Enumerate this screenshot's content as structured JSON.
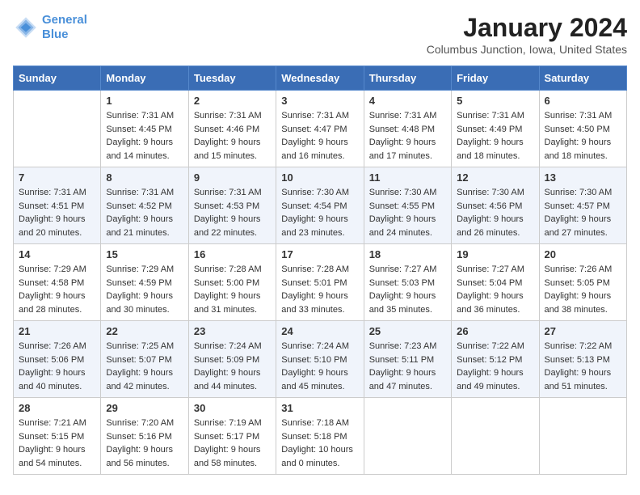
{
  "header": {
    "logo_line1": "General",
    "logo_line2": "Blue",
    "month_title": "January 2024",
    "location": "Columbus Junction, Iowa, United States"
  },
  "weekdays": [
    "Sunday",
    "Monday",
    "Tuesday",
    "Wednesday",
    "Thursday",
    "Friday",
    "Saturday"
  ],
  "weeks": [
    [
      {
        "day": "",
        "sunrise": "",
        "sunset": "",
        "daylight": ""
      },
      {
        "day": "1",
        "sunrise": "Sunrise: 7:31 AM",
        "sunset": "Sunset: 4:45 PM",
        "daylight": "Daylight: 9 hours and 14 minutes."
      },
      {
        "day": "2",
        "sunrise": "Sunrise: 7:31 AM",
        "sunset": "Sunset: 4:46 PM",
        "daylight": "Daylight: 9 hours and 15 minutes."
      },
      {
        "day": "3",
        "sunrise": "Sunrise: 7:31 AM",
        "sunset": "Sunset: 4:47 PM",
        "daylight": "Daylight: 9 hours and 16 minutes."
      },
      {
        "day": "4",
        "sunrise": "Sunrise: 7:31 AM",
        "sunset": "Sunset: 4:48 PM",
        "daylight": "Daylight: 9 hours and 17 minutes."
      },
      {
        "day": "5",
        "sunrise": "Sunrise: 7:31 AM",
        "sunset": "Sunset: 4:49 PM",
        "daylight": "Daylight: 9 hours and 18 minutes."
      },
      {
        "day": "6",
        "sunrise": "Sunrise: 7:31 AM",
        "sunset": "Sunset: 4:50 PM",
        "daylight": "Daylight: 9 hours and 18 minutes."
      }
    ],
    [
      {
        "day": "7",
        "sunrise": "Sunrise: 7:31 AM",
        "sunset": "Sunset: 4:51 PM",
        "daylight": "Daylight: 9 hours and 20 minutes."
      },
      {
        "day": "8",
        "sunrise": "Sunrise: 7:31 AM",
        "sunset": "Sunset: 4:52 PM",
        "daylight": "Daylight: 9 hours and 21 minutes."
      },
      {
        "day": "9",
        "sunrise": "Sunrise: 7:31 AM",
        "sunset": "Sunset: 4:53 PM",
        "daylight": "Daylight: 9 hours and 22 minutes."
      },
      {
        "day": "10",
        "sunrise": "Sunrise: 7:30 AM",
        "sunset": "Sunset: 4:54 PM",
        "daylight": "Daylight: 9 hours and 23 minutes."
      },
      {
        "day": "11",
        "sunrise": "Sunrise: 7:30 AM",
        "sunset": "Sunset: 4:55 PM",
        "daylight": "Daylight: 9 hours and 24 minutes."
      },
      {
        "day": "12",
        "sunrise": "Sunrise: 7:30 AM",
        "sunset": "Sunset: 4:56 PM",
        "daylight": "Daylight: 9 hours and 26 minutes."
      },
      {
        "day": "13",
        "sunrise": "Sunrise: 7:30 AM",
        "sunset": "Sunset: 4:57 PM",
        "daylight": "Daylight: 9 hours and 27 minutes."
      }
    ],
    [
      {
        "day": "14",
        "sunrise": "Sunrise: 7:29 AM",
        "sunset": "Sunset: 4:58 PM",
        "daylight": "Daylight: 9 hours and 28 minutes."
      },
      {
        "day": "15",
        "sunrise": "Sunrise: 7:29 AM",
        "sunset": "Sunset: 4:59 PM",
        "daylight": "Daylight: 9 hours and 30 minutes."
      },
      {
        "day": "16",
        "sunrise": "Sunrise: 7:28 AM",
        "sunset": "Sunset: 5:00 PM",
        "daylight": "Daylight: 9 hours and 31 minutes."
      },
      {
        "day": "17",
        "sunrise": "Sunrise: 7:28 AM",
        "sunset": "Sunset: 5:01 PM",
        "daylight": "Daylight: 9 hours and 33 minutes."
      },
      {
        "day": "18",
        "sunrise": "Sunrise: 7:27 AM",
        "sunset": "Sunset: 5:03 PM",
        "daylight": "Daylight: 9 hours and 35 minutes."
      },
      {
        "day": "19",
        "sunrise": "Sunrise: 7:27 AM",
        "sunset": "Sunset: 5:04 PM",
        "daylight": "Daylight: 9 hours and 36 minutes."
      },
      {
        "day": "20",
        "sunrise": "Sunrise: 7:26 AM",
        "sunset": "Sunset: 5:05 PM",
        "daylight": "Daylight: 9 hours and 38 minutes."
      }
    ],
    [
      {
        "day": "21",
        "sunrise": "Sunrise: 7:26 AM",
        "sunset": "Sunset: 5:06 PM",
        "daylight": "Daylight: 9 hours and 40 minutes."
      },
      {
        "day": "22",
        "sunrise": "Sunrise: 7:25 AM",
        "sunset": "Sunset: 5:07 PM",
        "daylight": "Daylight: 9 hours and 42 minutes."
      },
      {
        "day": "23",
        "sunrise": "Sunrise: 7:24 AM",
        "sunset": "Sunset: 5:09 PM",
        "daylight": "Daylight: 9 hours and 44 minutes."
      },
      {
        "day": "24",
        "sunrise": "Sunrise: 7:24 AM",
        "sunset": "Sunset: 5:10 PM",
        "daylight": "Daylight: 9 hours and 45 minutes."
      },
      {
        "day": "25",
        "sunrise": "Sunrise: 7:23 AM",
        "sunset": "Sunset: 5:11 PM",
        "daylight": "Daylight: 9 hours and 47 minutes."
      },
      {
        "day": "26",
        "sunrise": "Sunrise: 7:22 AM",
        "sunset": "Sunset: 5:12 PM",
        "daylight": "Daylight: 9 hours and 49 minutes."
      },
      {
        "day": "27",
        "sunrise": "Sunrise: 7:22 AM",
        "sunset": "Sunset: 5:13 PM",
        "daylight": "Daylight: 9 hours and 51 minutes."
      }
    ],
    [
      {
        "day": "28",
        "sunrise": "Sunrise: 7:21 AM",
        "sunset": "Sunset: 5:15 PM",
        "daylight": "Daylight: 9 hours and 54 minutes."
      },
      {
        "day": "29",
        "sunrise": "Sunrise: 7:20 AM",
        "sunset": "Sunset: 5:16 PM",
        "daylight": "Daylight: 9 hours and 56 minutes."
      },
      {
        "day": "30",
        "sunrise": "Sunrise: 7:19 AM",
        "sunset": "Sunset: 5:17 PM",
        "daylight": "Daylight: 9 hours and 58 minutes."
      },
      {
        "day": "31",
        "sunrise": "Sunrise: 7:18 AM",
        "sunset": "Sunset: 5:18 PM",
        "daylight": "Daylight: 10 hours and 0 minutes."
      },
      {
        "day": "",
        "sunrise": "",
        "sunset": "",
        "daylight": ""
      },
      {
        "day": "",
        "sunrise": "",
        "sunset": "",
        "daylight": ""
      },
      {
        "day": "",
        "sunrise": "",
        "sunset": "",
        "daylight": ""
      }
    ]
  ]
}
